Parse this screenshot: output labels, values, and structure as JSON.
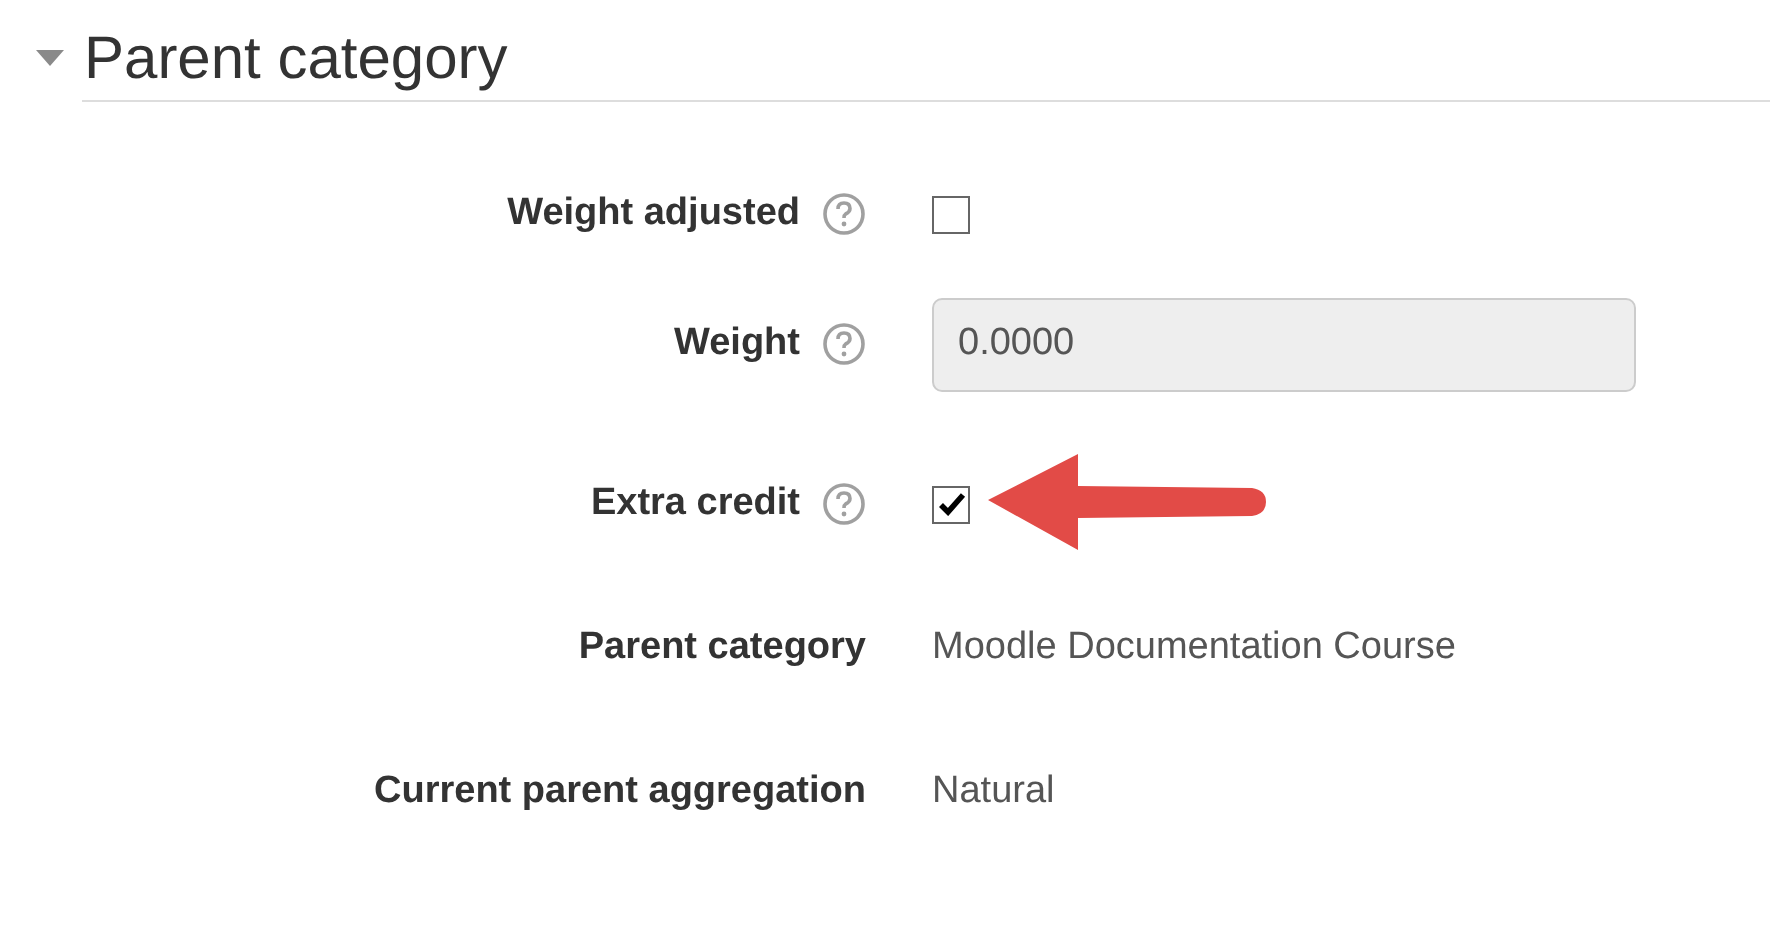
{
  "section": {
    "title": "Parent category",
    "expanded": true
  },
  "fields": [
    {
      "kind": "checkbox",
      "label": "Weight adjusted",
      "help": true,
      "checked": false
    },
    {
      "kind": "text",
      "label": "Weight",
      "help": true,
      "value": "0.0000",
      "disabled": true
    },
    {
      "kind": "checkbox",
      "label": "Extra credit",
      "help": true,
      "checked": true
    },
    {
      "kind": "static",
      "label": "Parent category",
      "value": "Moodle Documentation Course"
    },
    {
      "kind": "static",
      "label": "Current parent aggregation",
      "value": "Natural"
    }
  ]
}
